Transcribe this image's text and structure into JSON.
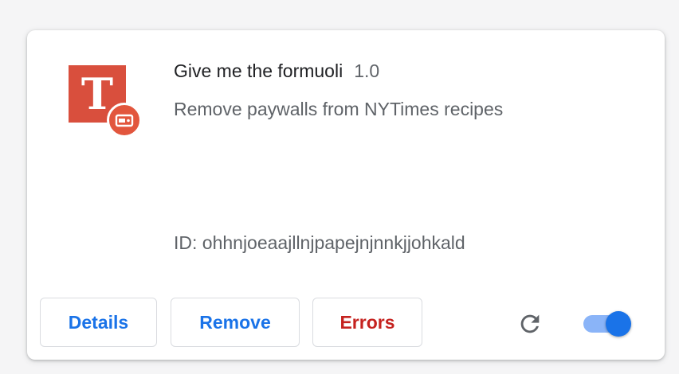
{
  "extension": {
    "name": "Give me the formuoli",
    "version": "1.0",
    "description": "Remove paywalls from NYTimes recipes",
    "id_text": "ID: ohhnjoeaajllnjpapejnjnnkjjohkald",
    "icon": "nytimes-t-logo",
    "icon_letter": "T",
    "badge_icon": "unpacked-extension-badge",
    "enabled": true
  },
  "buttons": {
    "details": "Details",
    "remove": "Remove",
    "errors": "Errors"
  },
  "controls": {
    "reload_icon": "reload-icon",
    "toggle_state": "on"
  },
  "colors": {
    "icon_background": "#d94f3d",
    "badge_background": "#e2563d",
    "link_blue": "#1a73e8",
    "error_red": "#c5221f",
    "toggle_track": "#8ab4f8",
    "toggle_knob": "#1a73e8"
  }
}
